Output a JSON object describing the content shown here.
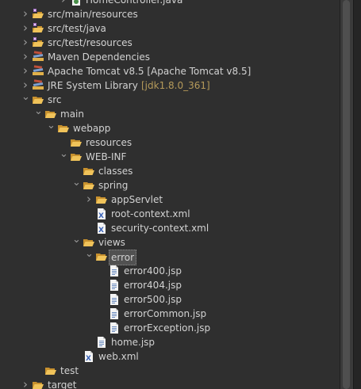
{
  "tree": {
    "rows": [
      {
        "label": "HomeController.java",
        "icon": "java-file-icon",
        "depth": 5,
        "twisty": "collapsed",
        "partial": true
      },
      {
        "label": "src/main/resources",
        "icon": "source-folder-icon",
        "depth": 2,
        "twisty": "collapsed"
      },
      {
        "label": "src/test/java",
        "icon": "source-folder-icon",
        "depth": 2,
        "twisty": "collapsed"
      },
      {
        "label": "src/test/resources",
        "icon": "source-folder-icon",
        "depth": 2,
        "twisty": "collapsed"
      },
      {
        "label": "Maven Dependencies",
        "icon": "library-icon",
        "depth": 2,
        "twisty": "collapsed"
      },
      {
        "label": "Apache Tomcat v8.5 [Apache Tomcat v8.5]",
        "icon": "library-icon",
        "depth": 2,
        "twisty": "collapsed"
      },
      {
        "label": "JRE System Library",
        "decoration": "[jdk1.8.0_361]",
        "icon": "library-icon",
        "depth": 2,
        "twisty": "collapsed"
      },
      {
        "label": "src",
        "icon": "folder-open-icon",
        "depth": 2,
        "twisty": "expanded"
      },
      {
        "label": "main",
        "icon": "folder-open-icon",
        "depth": 3,
        "twisty": "expanded"
      },
      {
        "label": "webapp",
        "icon": "folder-open-icon",
        "depth": 4,
        "twisty": "expanded"
      },
      {
        "label": "resources",
        "icon": "folder-open-icon",
        "depth": 5,
        "twisty": "none"
      },
      {
        "label": "WEB-INF",
        "icon": "folder-open-icon",
        "depth": 5,
        "twisty": "expanded"
      },
      {
        "label": "classes",
        "icon": "folder-open-icon",
        "depth": 6,
        "twisty": "none"
      },
      {
        "label": "spring",
        "icon": "folder-open-icon",
        "depth": 6,
        "twisty": "expanded"
      },
      {
        "label": "appServlet",
        "icon": "folder-open-icon",
        "depth": 7,
        "twisty": "collapsed"
      },
      {
        "label": "root-context.xml",
        "icon": "xml-file-icon",
        "depth": 7,
        "twisty": "none"
      },
      {
        "label": "security-context.xml",
        "icon": "xml-file-icon",
        "depth": 7,
        "twisty": "none"
      },
      {
        "label": "views",
        "icon": "folder-open-icon",
        "depth": 6,
        "twisty": "expanded"
      },
      {
        "label": "error",
        "icon": "folder-open-icon",
        "depth": 7,
        "twisty": "expanded",
        "selected": true
      },
      {
        "label": "error400.jsp",
        "icon": "jsp-file-icon",
        "depth": 8,
        "twisty": "none"
      },
      {
        "label": "error404.jsp",
        "icon": "jsp-file-icon",
        "depth": 8,
        "twisty": "none"
      },
      {
        "label": "error500.jsp",
        "icon": "jsp-file-icon",
        "depth": 8,
        "twisty": "none"
      },
      {
        "label": "errorCommon.jsp",
        "icon": "jsp-file-icon",
        "depth": 8,
        "twisty": "none"
      },
      {
        "label": "errorException.jsp",
        "icon": "jsp-file-icon",
        "depth": 8,
        "twisty": "none"
      },
      {
        "label": "home.jsp",
        "icon": "jsp-file-icon",
        "depth": 7,
        "twisty": "none"
      },
      {
        "label": "web.xml",
        "icon": "xml-file-icon",
        "depth": 6,
        "twisty": "none"
      },
      {
        "label": "test",
        "icon": "folder-open-icon",
        "depth": 3,
        "twisty": "none"
      },
      {
        "label": "target",
        "icon": "folder-open-icon",
        "depth": 2,
        "twisty": "collapsed"
      }
    ]
  },
  "colors": {
    "background": "#2f2f2f",
    "text": "#d2d2d2",
    "decoration": "#b59a5a",
    "folder": "#e0b04a",
    "selection": "#515151"
  }
}
